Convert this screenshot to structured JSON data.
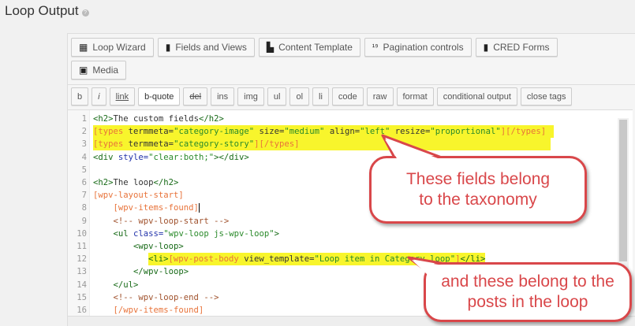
{
  "title": "Loop Output",
  "toolbar": [
    {
      "label": "Loop Wizard",
      "icon": "grid-icon",
      "glyph": "▦"
    },
    {
      "label": "Fields and Views",
      "icon": "toolset-icon",
      "glyph": "▮"
    },
    {
      "label": "Content Template",
      "icon": "template-icon",
      "glyph": "▙"
    },
    {
      "label": "Pagination controls",
      "icon": "pagination-icon",
      "glyph": "¹⁹"
    },
    {
      "label": "CRED Forms",
      "icon": "forms-icon",
      "glyph": "▮"
    },
    {
      "label": "Media",
      "icon": "image-icon",
      "glyph": "▣"
    }
  ],
  "quicktags": [
    "b",
    "i",
    "link",
    "b-quote",
    "del",
    "ins",
    "img",
    "ul",
    "ol",
    "li",
    "code",
    "raw",
    "format",
    "conditional output",
    "close tags"
  ],
  "code_lines": [
    [
      [
        "<h2>",
        "t"
      ],
      [
        "The custom fields",
        "p"
      ],
      [
        "</h2>",
        "t"
      ]
    ],
    [
      [
        "[types ",
        "sc"
      ],
      [
        "termmeta=",
        "p"
      ],
      [
        "\"category-image\"",
        "s"
      ],
      [
        " size=",
        "p"
      ],
      [
        "\"medium\"",
        "s"
      ],
      [
        " align=",
        "p"
      ],
      [
        "\"left\"",
        "s"
      ],
      [
        " resize=",
        "p"
      ],
      [
        "\"proportional\"",
        "s"
      ],
      [
        "][/types]",
        "sc"
      ]
    ],
    [
      [
        "[types ",
        "sc"
      ],
      [
        "termmeta=",
        "p"
      ],
      [
        "\"category-story\"",
        "s"
      ],
      [
        "][/types]",
        "sc"
      ]
    ],
    [
      [
        "<div ",
        "t"
      ],
      [
        "style=",
        "a"
      ],
      [
        "\"clear:both;\"",
        "s"
      ],
      [
        "></div>",
        "t"
      ]
    ],
    [],
    [
      [
        "<h2>",
        "t"
      ],
      [
        "The loop",
        "p"
      ],
      [
        "</h2>",
        "t"
      ]
    ],
    [
      [
        "[wpv-layout-start]",
        "sc"
      ]
    ],
    [
      [
        "    [wpv-items-found]",
        "sc"
      ]
    ],
    [
      [
        "    <!-- wpv-loop-start -->",
        "c"
      ]
    ],
    [
      [
        "    <ul ",
        "t"
      ],
      [
        "class=",
        "a"
      ],
      [
        "\"wpv-loop js-wpv-loop\"",
        "s"
      ],
      [
        ">",
        "t"
      ]
    ],
    [
      [
        "        <wpv-loop>",
        "t"
      ]
    ],
    [
      [
        "            ",
        "p"
      ],
      [
        "<li>",
        "t"
      ],
      [
        "[wpv-post-body ",
        "sc"
      ],
      [
        "view_template=",
        "p"
      ],
      [
        "\"Loop item in Category loop\"",
        "s"
      ],
      [
        "]",
        "sc"
      ],
      [
        "</li>",
        "t"
      ]
    ],
    [
      [
        "        </wpv-loop>",
        "t"
      ]
    ],
    [
      [
        "    </ul>",
        "t"
      ]
    ],
    [
      [
        "    <!-- wpv-loop-end -->",
        "c"
      ]
    ],
    [
      [
        "    [/wpv-items-found]",
        "sc"
      ]
    ]
  ],
  "highlighted_lines": [
    2,
    3,
    12
  ],
  "callouts": [
    "These fields belong to the taxonomy",
    "and these belong to the posts in the loop"
  ],
  "colors": {
    "callout": "#d9474a",
    "highlight": "#f8f52c"
  }
}
